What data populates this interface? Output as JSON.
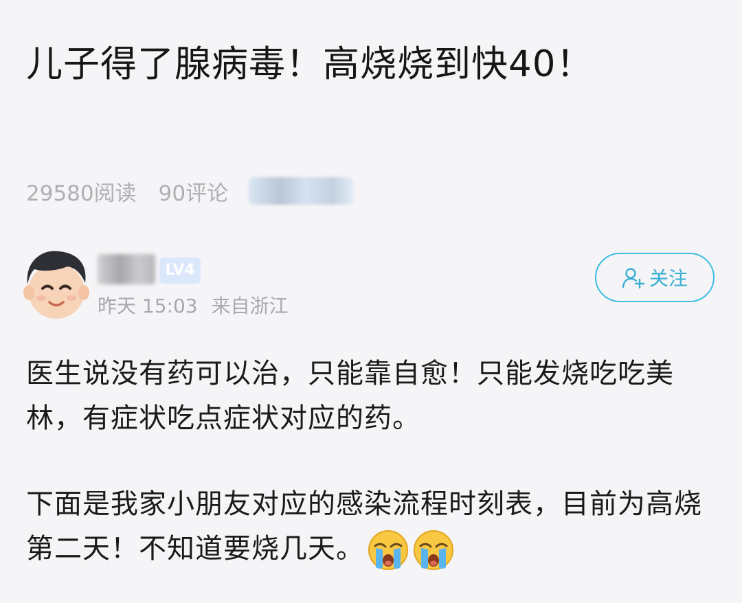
{
  "post": {
    "title": "儿子得了腺病毒！高烧烧到快40！",
    "reads": "29580阅读",
    "comments": "90评论"
  },
  "author": {
    "level": "LV4",
    "time": "昨天 15:03",
    "location": "来自浙江",
    "follow_label": "关注"
  },
  "content": {
    "paragraph1": "医生说没有药可以治，只能靠自愈！只能发烧吃吃美林，有症状吃点症状对应的药。",
    "paragraph2": "下面是我家小朋友对应的感染流程时刻表，目前为高烧第二天！不知道要烧几天。",
    "emoji_icons": [
      "loudly-crying-face-icon",
      "loudly-crying-face-icon"
    ]
  },
  "colors": {
    "accent": "#3dbde2",
    "muted_text": "#b0b0b3",
    "level_badge": "#dbe7fb",
    "background": "#f5f5f7"
  }
}
